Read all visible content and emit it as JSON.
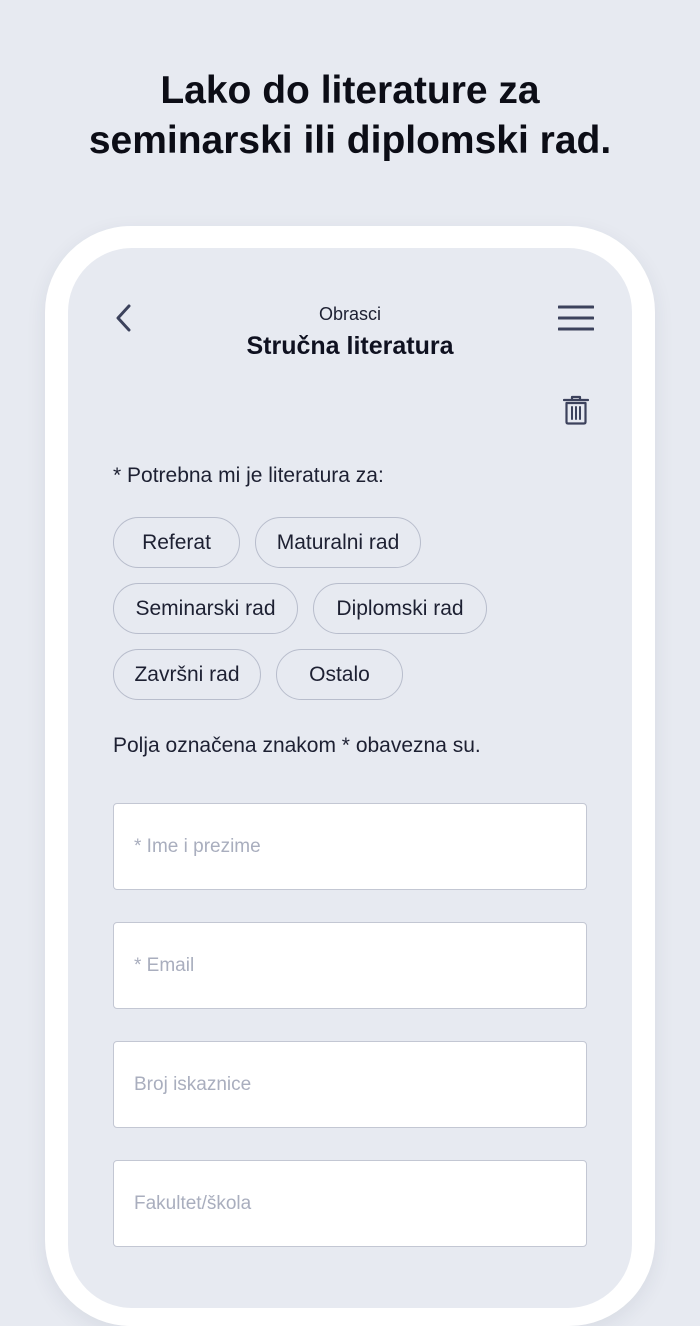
{
  "headline": {
    "line1": "Lako do literature za",
    "line2": "seminarski ili diplomski rad."
  },
  "nav": {
    "back_icon": "chevron-left-icon",
    "supertitle": "Obrasci",
    "title": "Stručna literatura",
    "menu_icon": "hamburger-menu-icon",
    "trash_icon": "trash-icon"
  },
  "form": {
    "question": "* Potrebna mi je literatura za:",
    "options": {
      "referat": "Referat",
      "maturalni": "Maturalni rad",
      "seminarski": "Seminarski rad",
      "diplomski": "Diplomski rad",
      "zavrsni": "Završni rad",
      "ostalo": "Ostalo"
    },
    "required_note": "Polja označena znakom * obavezna su.",
    "fields": {
      "name": {
        "placeholder": "* Ime i prezime",
        "value": ""
      },
      "email": {
        "placeholder": "* Email",
        "value": ""
      },
      "card": {
        "placeholder": "Broj iskaznice",
        "value": ""
      },
      "faculty": {
        "placeholder": "Fakultet/škola",
        "value": ""
      }
    }
  },
  "colors": {
    "background": "#e7eaf1",
    "frame": "#ffffff",
    "text": "#1d2032",
    "chip_border": "#b8bdcc",
    "icon": "#3c425c"
  }
}
